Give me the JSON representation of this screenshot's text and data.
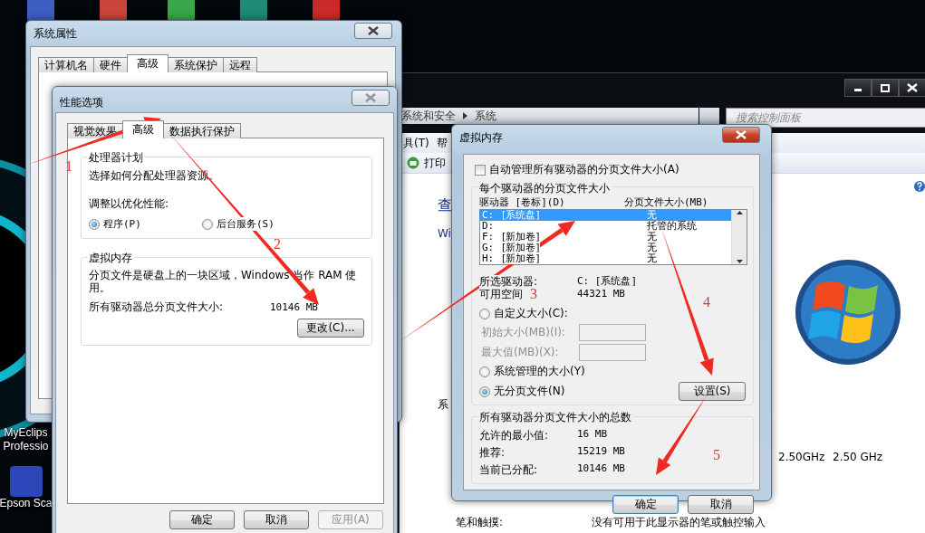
{
  "desktop": {
    "icons": [
      {
        "lines": [
          "MyEclips",
          "Professio"
        ]
      },
      {
        "lines": [
          "Epson Sca"
        ]
      }
    ]
  },
  "control_panel": {
    "breadcrumb": [
      "系统和安全",
      "系统"
    ],
    "search": {
      "placeholder": "搜索控制面板"
    },
    "menu": [
      "具(T)",
      "帮"
    ],
    "toolbar": [
      {
        "label": "打印"
      }
    ],
    "content": {
      "heading": "查",
      "line_1": "Wi",
      "section": "系",
      "processor": "2.50GHz",
      "processor_speed": "2.50 GHz",
      "rows": [
        {
          "label": "笔和触摸:",
          "value": "没有可用于此显示器的笔或触控输入"
        }
      ]
    }
  },
  "system_properties": {
    "title": "系统属性",
    "tabs": [
      {
        "label": "计算机名",
        "selected": false
      },
      {
        "label": "硬件",
        "selected": false
      },
      {
        "label": "高级",
        "selected": true
      },
      {
        "label": "系统保护",
        "selected": false
      },
      {
        "label": "远程",
        "selected": false
      }
    ]
  },
  "performance_options": {
    "title": "性能选项",
    "tabs": [
      {
        "label": "视觉效果",
        "selected": false
      },
      {
        "label": "高级",
        "selected": true
      },
      {
        "label": "数据执行保护",
        "selected": false
      }
    ],
    "processor_group": {
      "title": "处理器计划",
      "description": "选择如何分配处理器资源。",
      "prompt": "调整以优化性能:",
      "options": [
        {
          "label": "程序(P)",
          "selected": true
        },
        {
          "label": "后台服务(S)",
          "selected": false
        }
      ]
    },
    "virtual_memory_group": {
      "title": "虚拟内存",
      "description": "分页文件是硬盘上的一块区域，Windows 当作 RAM 使用。",
      "total_label": "所有驱动器总分页文件大小:",
      "total_value": "10146 MB",
      "button": "更改(C)..."
    },
    "buttons": [
      {
        "label": "确定",
        "disabled": false
      },
      {
        "label": "取消",
        "disabled": false
      },
      {
        "label": "应用(A)",
        "disabled": true
      }
    ]
  },
  "virtual_memory": {
    "title": "虚拟内存",
    "auto_manage": {
      "label": "自动管理所有驱动器的分页文件大小(A)",
      "checked": false
    },
    "drives_group": {
      "title": "每个驱动器的分页文件大小",
      "columns": [
        "驱动器 [卷标](D)",
        "分页文件大小(MB)"
      ],
      "drives": [
        {
          "drive": "C:",
          "volume": "[系统盘]",
          "size": "无",
          "selected": true
        },
        {
          "drive": "D:",
          "size": "托管的系统",
          "selected": false
        },
        {
          "drive": "F:",
          "volume": "[新加卷]",
          "size": "无",
          "selected": false
        },
        {
          "drive": "G:",
          "volume": "[新加卷]",
          "size": "无",
          "selected": false
        },
        {
          "drive": "H:",
          "volume": "[新加卷]",
          "size": "无",
          "selected": false
        }
      ],
      "selected_drive_label": "所选驱动器:",
      "selected_drive": "C:  [系统盘]",
      "free_space_label": "可用空间",
      "free_space": "44321 MB",
      "options": [
        {
          "label": "自定义大小(C):",
          "selected": false,
          "fields": [
            {
              "label": "初始大小(MB)(I):",
              "disabled": true
            },
            {
              "label": "最大值(MB)(X):",
              "disabled": true
            }
          ]
        },
        {
          "label": "系统管理的大小(Y)",
          "selected": false
        },
        {
          "label": "无分页文件(N)",
          "selected": true
        }
      ],
      "set_button": "设置(S)"
    },
    "totals_group": {
      "title": "所有驱动器分页文件大小的总数",
      "rows": [
        {
          "label": "允许的最小值:",
          "value": "16 MB"
        },
        {
          "label": "推荐:",
          "value": "15219 MB"
        },
        {
          "label": "当前已分配:",
          "value": "10146 MB"
        }
      ]
    },
    "buttons": [
      {
        "label": "确定",
        "default": true
      },
      {
        "label": "取消",
        "default": false
      }
    ]
  },
  "annotations": [
    {
      "number": "1"
    },
    {
      "number": "2"
    },
    {
      "number": "3"
    },
    {
      "number": "4"
    },
    {
      "number": "5"
    }
  ]
}
